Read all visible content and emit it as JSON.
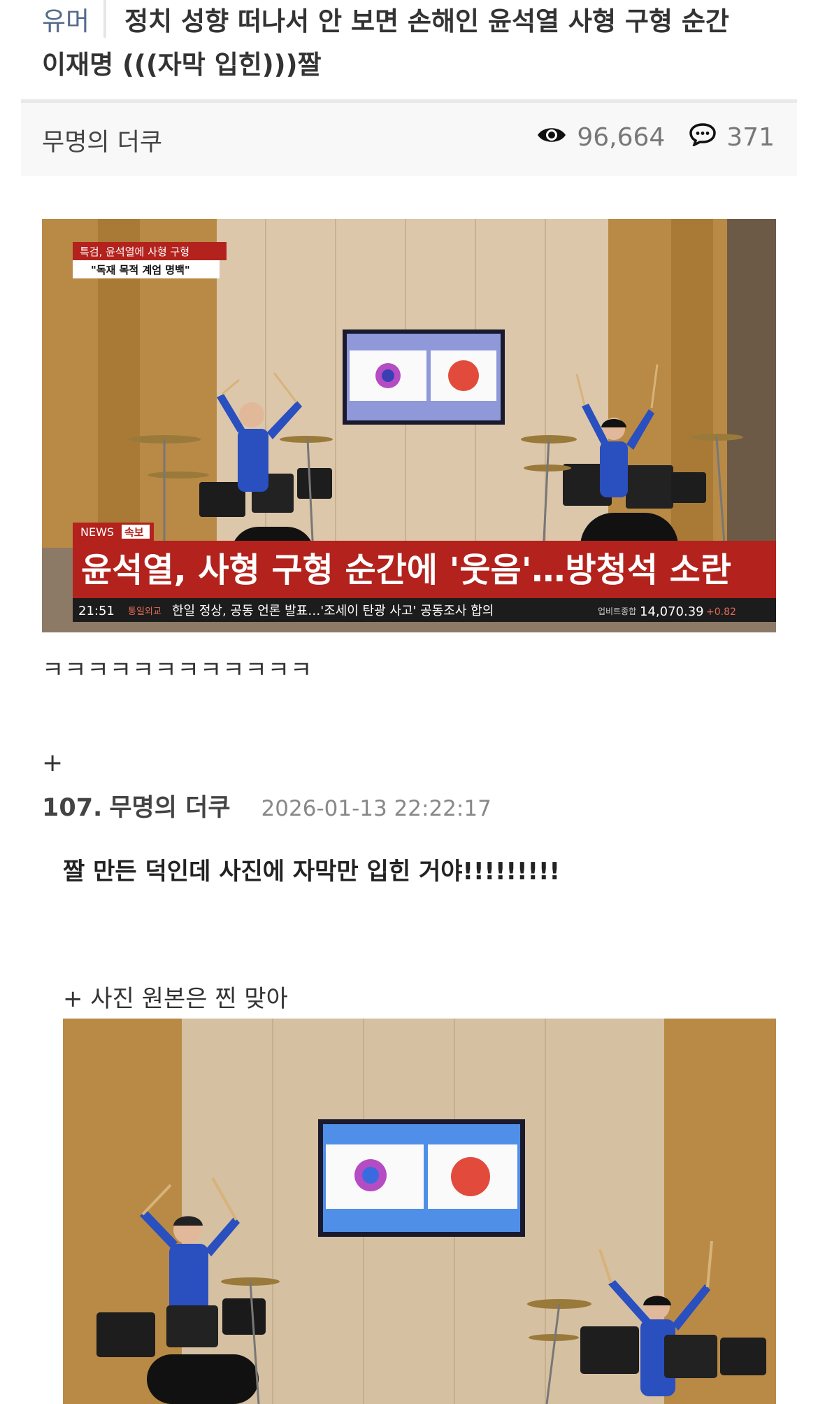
{
  "post": {
    "category": "유머",
    "title_line1": "정치 성향 떠나서 안 보면 손해인 윤석열 사형 구형 순간",
    "title_line2": "이재명 (((자막 입힌)))짤",
    "author": "무명의 더쿠",
    "views": "96,664",
    "comments": "371"
  },
  "image1": {
    "badge_top": "특검, 윤석열에 사형 구형",
    "badge_quote": "\"독재 목적 계엄 명백\"",
    "news_label": "NEWS",
    "breaking_label": "속보",
    "headline": "윤석열, 사형 구형 순간에 '웃음'…방청석 소란",
    "time": "21:51",
    "ticker_tag": "통일외교",
    "ticker": "한일 정상, 공동 언론 발표…'조세이 탄광 사고' 공동조사 합의",
    "index_label": "업비트종합",
    "index_value": "14,070.39",
    "index_change": "+0.82"
  },
  "body": {
    "laugh": "ㅋㅋㅋㅋㅋㅋㅋㅋㅋㅋㅋㅋ",
    "plus": "+"
  },
  "comment": {
    "number": "107.",
    "author": "무명의 더쿠",
    "date": "2026-01-13 22:22:17",
    "text": "짤 만든 덕인데 사진에 자막만 입힌 거야!!!!!!!!!",
    "note": "+ 사진 원본은 찐 맞아"
  },
  "colors": {
    "category": "#556a8c",
    "news_red": "#b3221c",
    "wall_wood": "#b8863f",
    "wall_panel": "#d8c3a5",
    "jersey_blue": "#2a4fbf"
  }
}
